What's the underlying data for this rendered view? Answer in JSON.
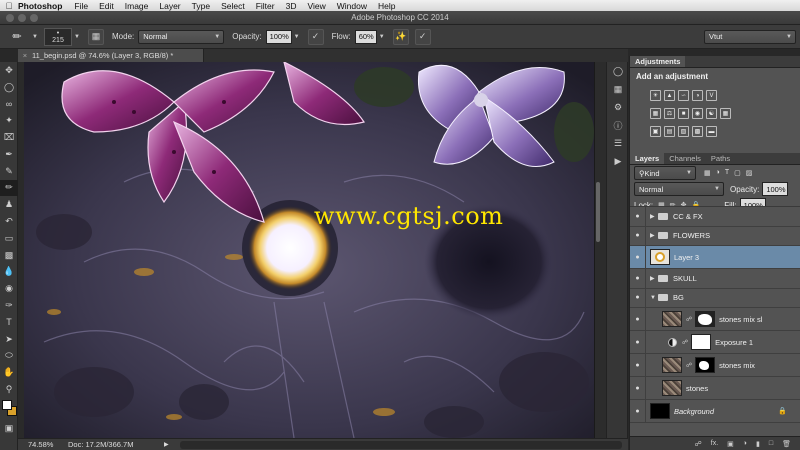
{
  "menubar": {
    "app": "Photoshop",
    "menus": [
      "File",
      "Edit",
      "Image",
      "Layer",
      "Type",
      "Select",
      "Filter",
      "3D",
      "View",
      "Window",
      "Help"
    ]
  },
  "window": {
    "title": "Adobe Photoshop CC 2014"
  },
  "options": {
    "brush_size": "215",
    "mode_label": "Mode:",
    "mode_value": "Normal",
    "opacity_label": "Opacity:",
    "opacity_value": "100%",
    "flow_label": "Flow:",
    "flow_value": "60%",
    "workspace": "Vtut"
  },
  "document": {
    "tab_title": "11_begin.psd @ 74.6% (Layer 3, RGB/8) *",
    "zoom": "74.58%",
    "doc_size": "Doc: 17.2M/366.7M"
  },
  "watermark": "www.cgtsj.com",
  "adjustments": {
    "tab": "Adjustments",
    "title": "Add an adjustment"
  },
  "layers_panel": {
    "tabs": [
      "Layers",
      "Channels",
      "Paths"
    ],
    "filter_kind": "Kind",
    "blend_mode": "Normal",
    "opacity_label": "Opacity:",
    "opacity_value": "100%",
    "lock_label": "Lock:",
    "fill_label": "Fill:",
    "fill_value": "100%",
    "layers": [
      {
        "name": "CC & FX",
        "kind": "group"
      },
      {
        "name": "FLOWERS",
        "kind": "group"
      },
      {
        "name": "Layer 3",
        "kind": "layer",
        "selected": true
      },
      {
        "name": "SKULL",
        "kind": "group"
      },
      {
        "name": "BG",
        "kind": "group-open"
      },
      {
        "name": "stones mix sl",
        "kind": "masked"
      },
      {
        "name": "Exposure 1",
        "kind": "adjustment"
      },
      {
        "name": "stones mix",
        "kind": "masked"
      },
      {
        "name": "stones",
        "kind": "pixel"
      },
      {
        "name": "Background",
        "kind": "background"
      }
    ]
  },
  "colors": {
    "foreground": "#ffffff",
    "background": "#d9a12b",
    "selected_layer": "#6a8aa8"
  }
}
